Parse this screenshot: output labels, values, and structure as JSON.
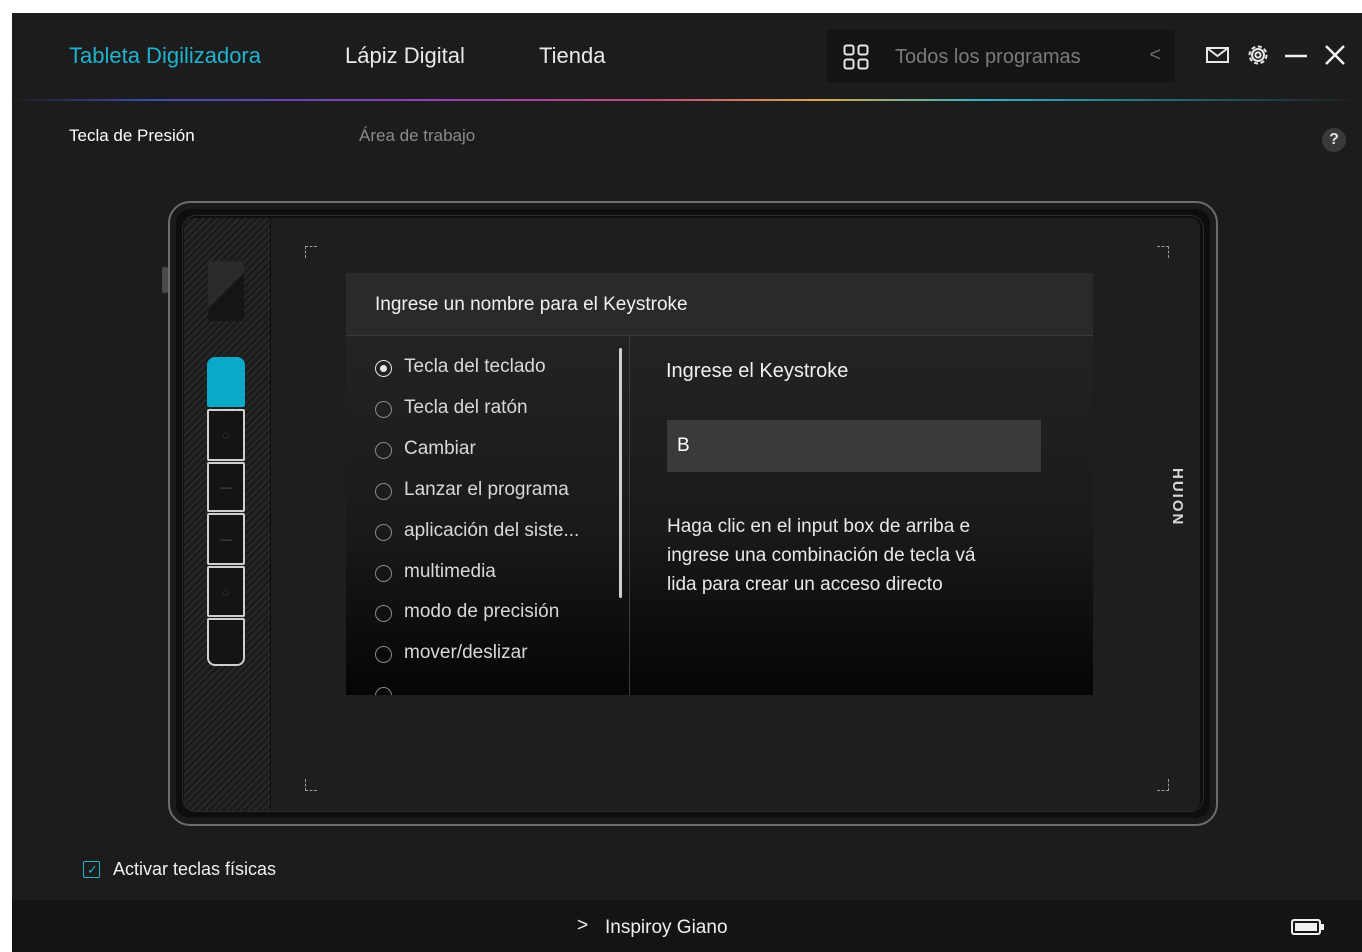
{
  "header": {
    "tabs": [
      {
        "label": "Tableta Digilizadora",
        "active": true
      },
      {
        "label": "Lápiz Digital",
        "active": false
      },
      {
        "label": "Tienda",
        "active": false
      }
    ],
    "program_selector": {
      "label": "Todos los programas",
      "icon": "grid-icon",
      "arrow": "<"
    },
    "window_icons": [
      "mail-icon",
      "gear-icon",
      "minimize-icon",
      "close-icon"
    ]
  },
  "subtabs": [
    {
      "label": "Tecla de Presión",
      "active": true
    },
    {
      "label": "Área de trabajo",
      "active": false
    }
  ],
  "help": {
    "label": "?"
  },
  "tablet": {
    "brand": "HUION",
    "express_keys_count": 6,
    "selected_key_index": 0
  },
  "dialog": {
    "title": "Ingrese un nombre para el Keystroke",
    "options": [
      {
        "label": "Tecla del teclado",
        "checked": true
      },
      {
        "label": "Tecla del ratón",
        "checked": false
      },
      {
        "label": "Cambiar",
        "checked": false
      },
      {
        "label": "Lanzar el programa",
        "checked": false
      },
      {
        "label": "aplicación del siste...",
        "checked": false
      },
      {
        "label": "multimedia",
        "checked": false
      },
      {
        "label": "modo de precisión",
        "checked": false
      },
      {
        "label": "mover/deslizar",
        "checked": false
      }
    ],
    "keystroke_label": "Ingrese el Keystroke",
    "keystroke_value": "B",
    "help_lines": [
      "Haga clic en el input box de arriba e",
      "ingrese una combinación de tecla vá",
      "lida para crear un acceso directo"
    ]
  },
  "physical_keys": {
    "label": "Activar teclas físicas",
    "checked": true
  },
  "footer": {
    "device_name": "Inspiroy Giano",
    "chevron": ">",
    "battery_icon": "battery-icon"
  },
  "colors": {
    "accent": "#1fb3cf",
    "key_selected": "#0aa9c8",
    "background": "#1c1c1c"
  }
}
